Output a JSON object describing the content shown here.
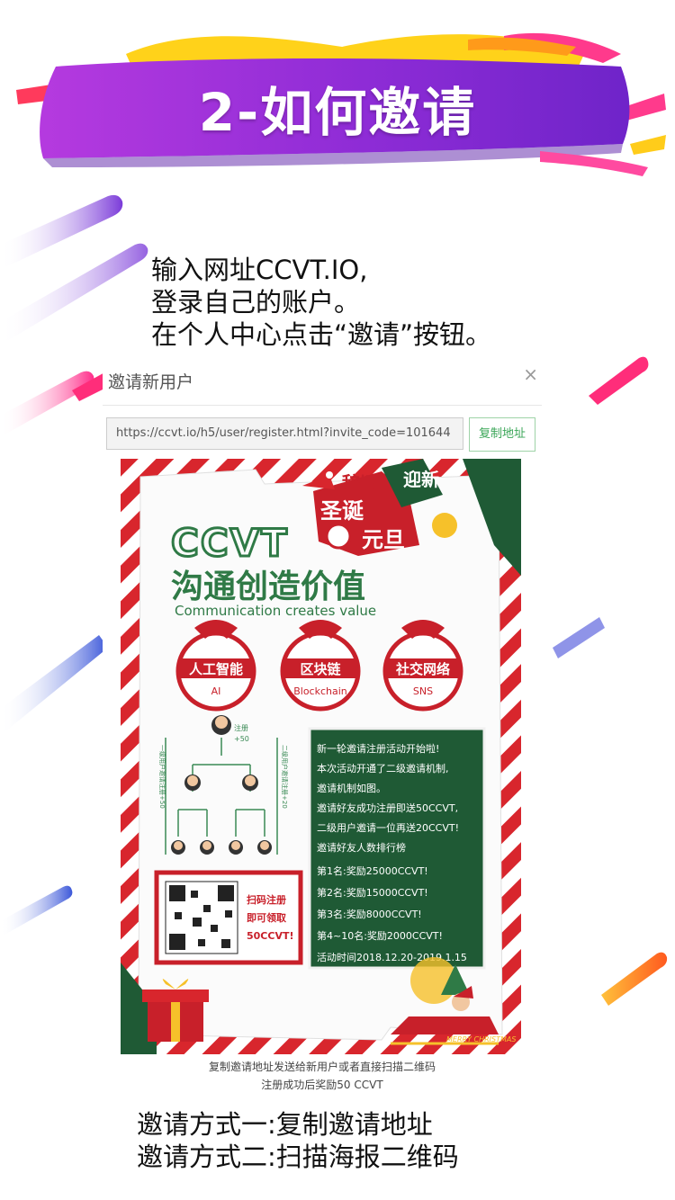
{
  "banner": {
    "title": "2-如何邀请"
  },
  "intro": {
    "line1": "输入网址CCVT.IO,",
    "line2": "登录自己的账户。",
    "line3": "在个人中心点击“邀请”按钮。"
  },
  "modal": {
    "title": "邀请新用户",
    "close": "×",
    "url": "https://ccvt.io/h5/user/register.html?invite_code=101644",
    "copy_button": "复制地址",
    "caption_line1": "复制邀请地址发送给新用户或者直接扫描二维码",
    "caption_line2": "注册成功后奖励50 CCVT"
  },
  "poster": {
    "holiday_1": "辞旧",
    "holiday_2": "迎新",
    "holiday_3": "圣诞",
    "holiday_4": "元旦",
    "brand": "CCVT",
    "slogan": "沟通创造价值",
    "slogan_en": "Communication creates value",
    "badges": [
      {
        "cn": "人工智能",
        "en": "AI"
      },
      {
        "cn": "区块链",
        "en": "Blockchain"
      },
      {
        "cn": "社交网络",
        "en": "SNS"
      }
    ],
    "tree_register": "注册",
    "tree_reward": "+50",
    "tree_side_left": "一级用户邀请注册+50",
    "tree_side_right": "二级用户邀请注册+20",
    "qr_text1": "扫码注册",
    "qr_text2": "即可领取",
    "qr_text3": "50CCVT!",
    "info": [
      "新一轮邀请注册活动开始啦!",
      "本次活动开通了二级邀请机制,",
      "邀请机制如图。",
      "邀请好友成功注册即送50CCVT,",
      "二级用户邀请一位再送20CCVT!",
      "邀请好友人数排行榜",
      "第1名:奖励25000CCVT!",
      "第2名:奖励15000CCVT!",
      "第3名:奖励8000CCVT!",
      "第4~10名:奖励2000CCVT!",
      "活动时间2018.12.20-2019.1.15"
    ],
    "merry": "MERRY CHRISTMAS"
  },
  "outro": {
    "line1": "邀请方式一:复制邀请地址",
    "line2": "邀请方式二:扫描海报二维码"
  },
  "colors": {
    "purple": "#8a2be2",
    "pink": "#ff2d7a",
    "red": "#c8202a",
    "green": "#1f5a35",
    "gold": "#f6c12a"
  }
}
